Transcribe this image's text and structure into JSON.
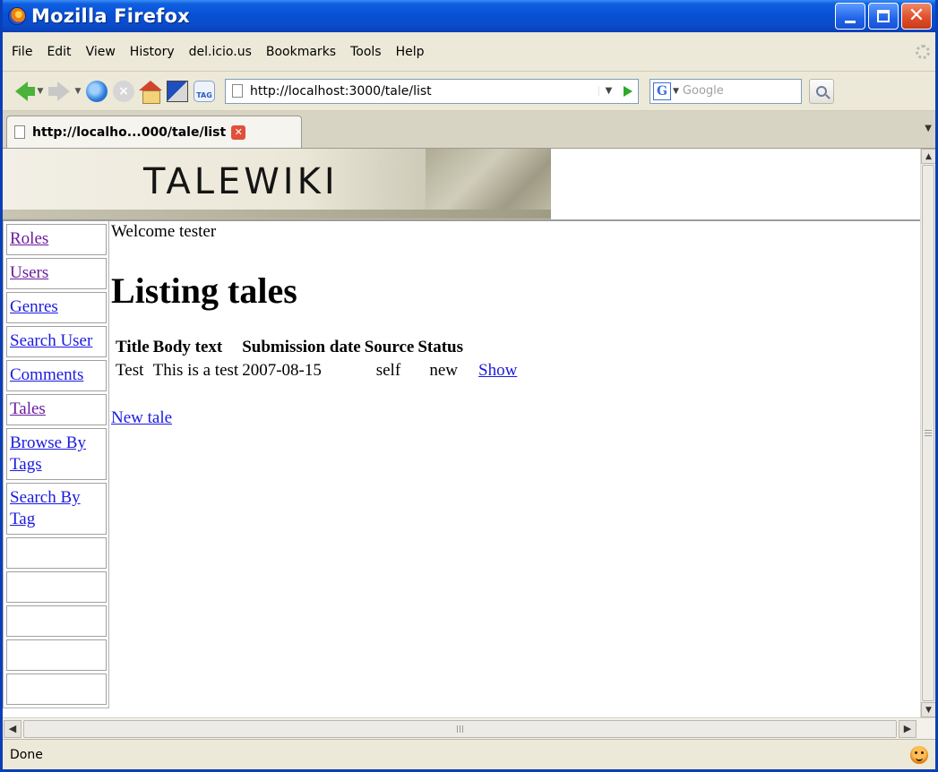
{
  "window": {
    "title": "Mozilla Firefox"
  },
  "menubar": {
    "items": [
      "File",
      "Edit",
      "View",
      "History",
      "del.icio.us",
      "Bookmarks",
      "Tools",
      "Help"
    ]
  },
  "toolbar": {
    "url": "http://localhost:3000/tale/list",
    "search_placeholder": "Google",
    "tag_button_label": "TAG"
  },
  "tab": {
    "label": "http://localho...000/tale/list"
  },
  "page": {
    "banner_title": "TALEWIKI",
    "welcome": "Welcome tester",
    "heading": "Listing tales",
    "nav_links": [
      {
        "label": "Roles",
        "visited": true
      },
      {
        "label": "Users",
        "visited": true
      },
      {
        "label": "Genres",
        "visited": false
      },
      {
        "label": "Search User",
        "visited": false
      },
      {
        "label": "Comments",
        "visited": false
      },
      {
        "label": "Tales",
        "visited": true
      },
      {
        "label": "Browse By Tags",
        "visited": false
      },
      {
        "label": "Search By Tag",
        "visited": false
      }
    ],
    "empty_nav_cells": 5,
    "table": {
      "headers": [
        "Title",
        "Body text",
        "Submission date",
        "Source",
        "Status"
      ],
      "rows": [
        {
          "cells": [
            "Test",
            "This is a test",
            "2007-08-15",
            "self",
            "new"
          ],
          "action": "Show"
        }
      ]
    },
    "new_link": "New tale"
  },
  "status": {
    "text": "Done"
  },
  "icons": {
    "app": "firefox-icon",
    "back": "back-arrow-icon",
    "forward": "forward-arrow-icon",
    "reload": "reload-icon",
    "stop": "stop-icon",
    "home": "home-icon",
    "search": "magnifier-icon",
    "status": "orange-smiley-icon"
  },
  "colors": {
    "titlebar": "#0751d6",
    "link": "#1a1ae0",
    "visited_link": "#6b1a9e",
    "close_button": "#e0502a",
    "banner": "#ebe7d8"
  }
}
